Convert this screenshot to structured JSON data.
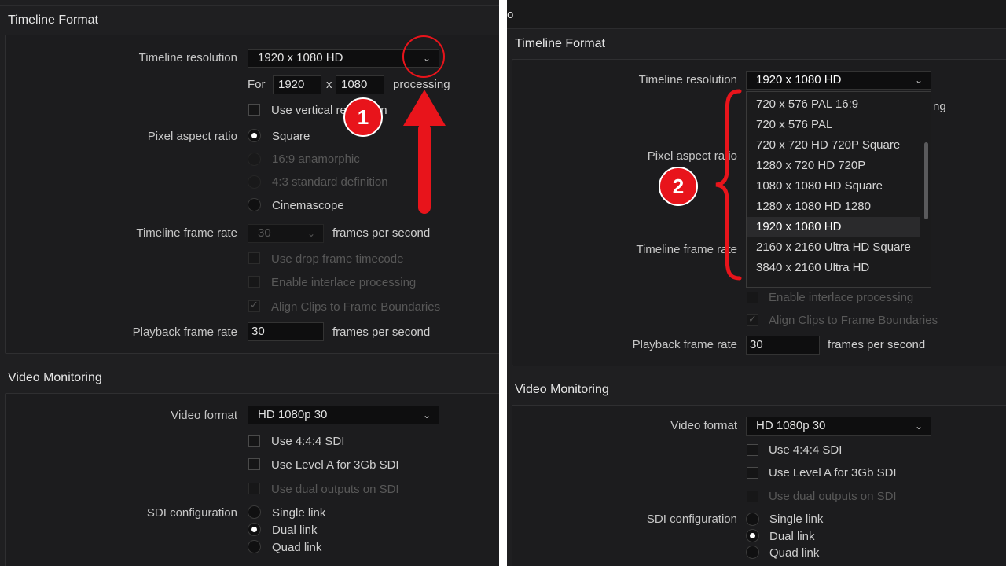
{
  "left": {
    "timeline_format": {
      "title": "Timeline Format",
      "resolution_label": "Timeline resolution",
      "resolution_value": "1920 x 1080 HD",
      "for_label": "For",
      "width": "1920",
      "x_label": "x",
      "height": "1080",
      "processing_label": "processing",
      "vertical_label": "Use vertical resolution",
      "pixel_aspect_label": "Pixel aspect ratio",
      "pixel_options": [
        "Square",
        "16:9 anamorphic",
        "4:3 standard definition",
        "Cinemascope"
      ],
      "frame_rate_label": "Timeline frame rate",
      "frame_rate_value": "30",
      "fps_label": "frames per second",
      "drop_frame_label": "Use drop frame timecode",
      "interlace_label": "Enable interlace processing",
      "align_label": "Align Clips to Frame Boundaries",
      "playback_label": "Playback frame rate",
      "playback_value": "30",
      "playback_fps_label": "frames per second"
    },
    "video_monitoring": {
      "title": "Video Monitoring",
      "format_label": "Video format",
      "format_value": "HD 1080p 30",
      "opt_444": "Use 4:4:4 SDI",
      "opt_levela": "Use Level A for 3Gb SDI",
      "opt_dual": "Use dual outputs on SDI",
      "sdi_label": "SDI configuration",
      "sdi_options": [
        "Single link",
        "Dual link",
        "Quad link"
      ]
    },
    "annotation_number": "1"
  },
  "right": {
    "top_cut_text": "o",
    "timeline_format": {
      "title": "Timeline Format",
      "resolution_label": "Timeline resolution",
      "resolution_value": "1920 x 1080 HD",
      "processing_partial": "ng",
      "pixel_aspect_label": "Pixel aspect ratio",
      "frame_rate_label": "Timeline frame rate",
      "interlace_label": "Enable interlace processing",
      "align_label": "Align Clips to Frame Boundaries",
      "playback_label": "Playback frame rate",
      "playback_value": "30",
      "playback_fps_label": "frames per second"
    },
    "dropdown_options": [
      "720 x 576 PAL 16:9",
      "720 x 576 PAL",
      "720 x 720 HD 720P Square",
      "1280 x 720 HD 720P",
      "1080 x 1080 HD Square",
      "1280 x 1080 HD 1280",
      "1920 x 1080 HD",
      "2160 x 2160 Ultra HD Square",
      "3840 x 2160 Ultra HD"
    ],
    "dropdown_selected": "1920 x 1080 HD",
    "video_monitoring": {
      "title": "Video Monitoring",
      "format_label": "Video format",
      "format_value": "HD 1080p 30",
      "opt_444": "Use 4:4:4 SDI",
      "opt_levela": "Use Level A for 3Gb SDI",
      "opt_dual": "Use dual outputs on SDI",
      "sdi_label": "SDI configuration",
      "sdi_options": [
        "Single link",
        "Dual link",
        "Quad link"
      ]
    },
    "annotation_number": "2"
  },
  "colors": {
    "annotation": "#e8141b",
    "panel_bg": "#1f1f21",
    "divider": "#ffffff"
  },
  "icons": {
    "dropdown": "chevron-down-icon",
    "checkmark": "check-icon"
  }
}
